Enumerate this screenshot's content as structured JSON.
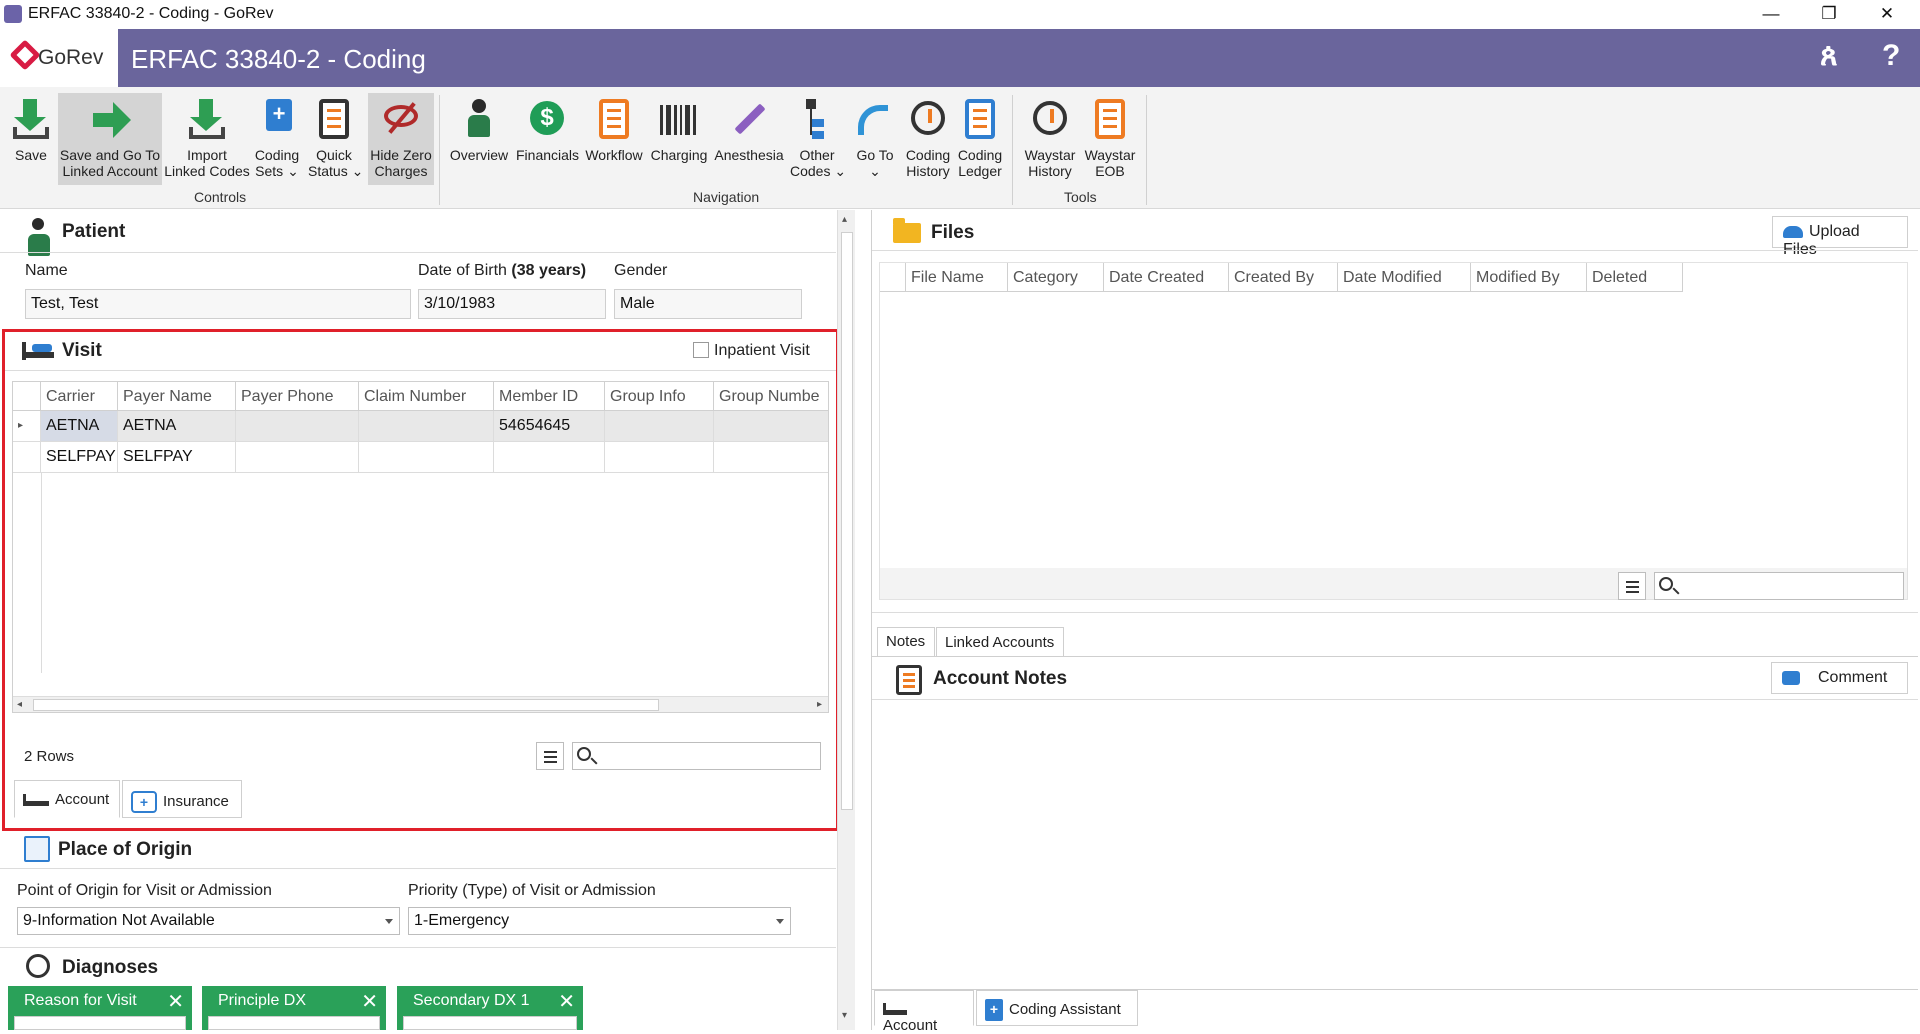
{
  "window": {
    "title": "ERFAC 33840-2 - Coding - GoRev",
    "minimize": "—",
    "restore": "❐",
    "close": "✕"
  },
  "header": {
    "logo_text": "GoRev",
    "title": "ERFAC 33840-2 - Coding",
    "user_icon": "ጰ",
    "help": "?"
  },
  "ribbon": {
    "controls": {
      "group_label": "Controls",
      "save": "Save",
      "save_go_1": "Save and Go To",
      "save_go_2": "Linked Account",
      "import_1": "Import",
      "import_2": "Linked Codes",
      "coding_sets_1": "Coding",
      "coding_sets_2": "Sets ⌄",
      "quick_status_1": "Quick",
      "quick_status_2": "Status ⌄",
      "hide_zero_1": "Hide Zero",
      "hide_zero_2": "Charges"
    },
    "navigation": {
      "group_label": "Navigation",
      "overview": "Overview",
      "financials": "Financials",
      "workflow": "Workflow",
      "charging": "Charging",
      "anesthesia": "Anesthesia",
      "other_codes_1": "Other",
      "other_codes_2": "Codes ⌄",
      "goto_1": "Go To",
      "goto_2": "⌄",
      "coding_history_1": "Coding",
      "coding_history_2": "History",
      "coding_ledger_1": "Coding",
      "coding_ledger_2": "Ledger"
    },
    "tools": {
      "group_label": "Tools",
      "waystar_history_1": "Waystar",
      "waystar_history_2": "History",
      "waystar_eob_1": "Waystar",
      "waystar_eob_2": "EOB"
    }
  },
  "patient": {
    "title": "Patient",
    "name_label": "Name",
    "name_value": "Test, Test",
    "dob_label": "Date of Birth",
    "dob_age": "(38 years)",
    "dob_value": "3/10/1983",
    "gender_label": "Gender",
    "gender_value": "Male"
  },
  "visit": {
    "title": "Visit",
    "inpatient_label": "Inpatient Visit",
    "columns": [
      "Carrier",
      "Payer Name",
      "Payer Phone",
      "Claim Number",
      "Member ID",
      "Group Info",
      "Group Numbe"
    ],
    "rows": [
      [
        "AETNA",
        "AETNA",
        "",
        "",
        "54654645",
        "",
        ""
      ],
      [
        "SELFPAY",
        "SELFPAY",
        "",
        "",
        "",
        "",
        ""
      ]
    ],
    "row_count": "2 Rows",
    "tabs": {
      "account": "Account",
      "insurance": "Insurance"
    }
  },
  "origin": {
    "title": "Place of Origin",
    "point_label": "Point of Origin for Visit or Admission",
    "point_value": "9-Information Not Available",
    "priority_label": "Priority (Type) of Visit or Admission",
    "priority_value": "1-Emergency"
  },
  "diagnoses": {
    "title": "Diagnoses",
    "buttons": [
      "Reason for Visit",
      "Principle DX",
      "Secondary DX 1"
    ],
    "remove": "✕"
  },
  "files": {
    "title": "Files",
    "upload": "Upload Files",
    "columns": [
      "File Name",
      "Category",
      "Date Created",
      "Created By",
      "Date Modified",
      "Modified By",
      "Deleted"
    ]
  },
  "notes": {
    "tabs": {
      "notes": "Notes",
      "linked": "Linked Accounts"
    },
    "title": "Account Notes",
    "comment": "Comment"
  },
  "bottom_tabs": {
    "account": "Account",
    "coding_assistant": "Coding Assistant"
  }
}
